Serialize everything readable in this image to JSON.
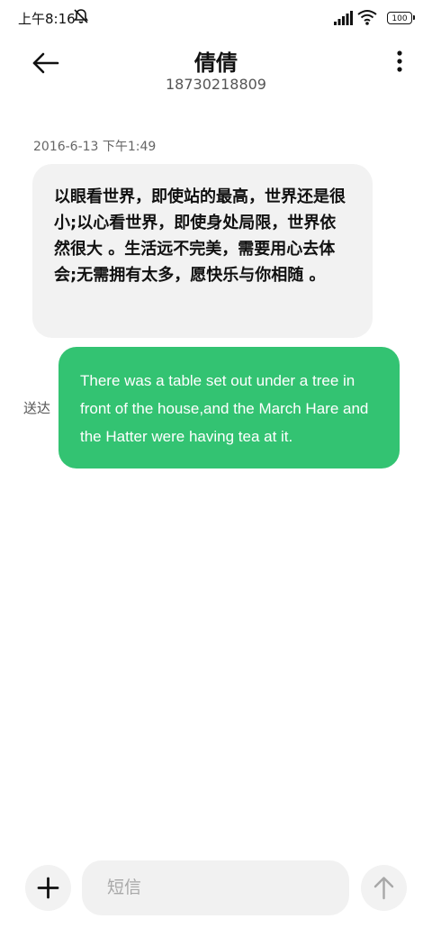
{
  "status_bar": {
    "time": "上午8:16",
    "battery": "100",
    "icons": [
      "mute-icon",
      "signal-icon",
      "wifi-icon",
      "battery-icon"
    ]
  },
  "header": {
    "contact_name": "倩倩",
    "contact_number": "18730218809",
    "icons": [
      "back-arrow-icon",
      "more-vertical-icon"
    ]
  },
  "conversation": {
    "timestamp": "2016-6-13 下午1:49",
    "incoming_message": "以眼看世界，即使站的最高，世界还是很小;以心看世界，即使身处局限，世界依然很大 。生活远不完美，需要用心去体会;无需拥有太多，愿快乐与你相随 。",
    "outgoing_message": "There was a table set out under a tree in front of the house,and the March Hare and the Hatter were having tea at it.",
    "outgoing_status": "送达"
  },
  "composer": {
    "placeholder": "短信",
    "icons": [
      "plus-icon",
      "send-arrow-icon"
    ]
  },
  "colors": {
    "outgoing_bubble": "#33c372",
    "incoming_bubble": "#f2f2f2",
    "input_background": "#f1f1f1"
  }
}
